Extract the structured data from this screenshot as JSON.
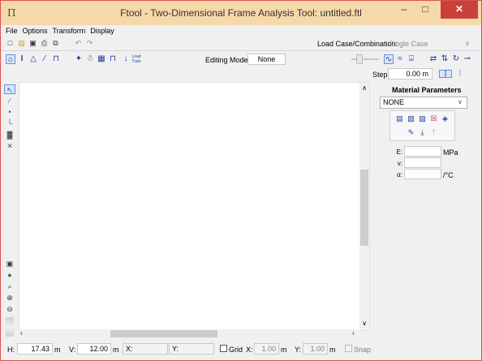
{
  "window": {
    "title": "Ftool - Two-Dimensional Frame Analysis Tool: untitled.ftl",
    "icon": "ftool-app-icon",
    "minimize": "–",
    "maximize": "□",
    "close": "✕"
  },
  "menu": [
    "File",
    "Options",
    "Transform",
    "Display"
  ],
  "toolbar1": {
    "icons": [
      "new-file-icon",
      "open-folder-icon",
      "save-icon",
      "print-icon",
      "copy-icon",
      "undo-icon",
      "redo-icon"
    ],
    "load_case_label": "Load Case/Combination:",
    "load_case_value": "Single Case"
  },
  "toolbar2": {
    "icons": [
      "structure-icon",
      "section-icon",
      "support-icon",
      "hinge-icon",
      "frame-icon",
      "loads-icon",
      "temperature-icon",
      "grid-icon",
      "moment-icon",
      "load-train-icon"
    ],
    "load_train_label": "Load\nTrain",
    "editing_mode_label": "Editing Mode:",
    "editing_mode_value": "None",
    "right_icons": [
      "scale-icon",
      "diagram-icon",
      "deformed-icon",
      "reaction-icon",
      "normal-icon",
      "shear-icon",
      "moment-diagram-icon"
    ]
  },
  "step": {
    "label": "Step:",
    "value": "0.00",
    "unit": "m"
  },
  "left_toolbar": [
    "select-icon",
    "line-icon",
    "point-icon",
    "dimension-icon",
    "grid-toggle-icon",
    "delete-icon",
    "monitor-icon",
    "globe-icon",
    "zoom-icon",
    "zoom-in-icon",
    "zoom-out-icon"
  ],
  "material": {
    "title": "Material Parameters",
    "selected": "NONE",
    "icons": [
      "new-material-icon",
      "copy-material-icon",
      "rename-material-icon",
      "delete-material-icon",
      "apply-material-icon",
      "edit-material-icon",
      "import-material-icon",
      "export-material-icon"
    ],
    "E_label": "E:",
    "E_unit": "MPa",
    "nu_label": "ν:",
    "alpha_label": "α:",
    "alpha_unit": "/°C"
  },
  "status": {
    "h_label": "H:",
    "h_value": "17.43",
    "h_unit": "m",
    "v_label": "V:",
    "v_value": "12.00",
    "v_unit": "m",
    "x_label": "X:",
    "y_label": "Y:",
    "grid_label": "Grid",
    "grid_x_label": "X:",
    "grid_x_value": "1.00",
    "grid_x_unit": "m",
    "grid_y_label": "Y:",
    "grid_y_value": "1.00",
    "grid_y_unit": "m",
    "snap_label": "Snap"
  },
  "colors": {
    "titlebar": "#f5d9a8",
    "close_button": "#c9403a",
    "accent_blue": "#1c3f9e"
  }
}
